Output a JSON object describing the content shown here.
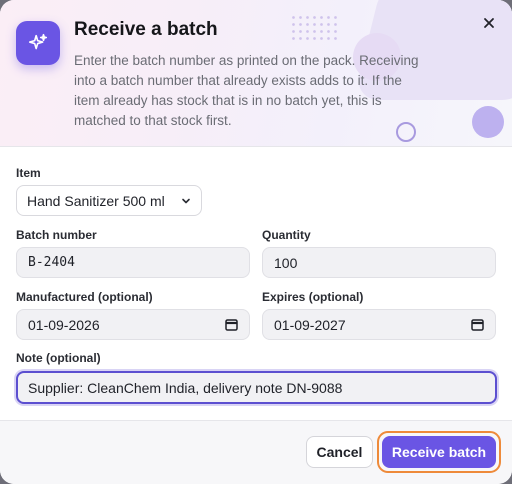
{
  "dialog": {
    "title": "Receive a batch",
    "description": "Enter the batch number as printed on the pack. Receiving into a batch number that already exists adds to it. If the item already has stock that is in no batch yet, this is matched to that stock first.",
    "icons": {
      "badge": "sparkles-icon",
      "close": "close-icon"
    },
    "accent_color": "#6a55e4"
  },
  "form": {
    "item": {
      "label": "Item",
      "value": "Hand Sanitizer 500 ml"
    },
    "batch_number": {
      "label": "Batch number",
      "value": "B-2404"
    },
    "quantity": {
      "label": "Quantity",
      "value": "100"
    },
    "manufactured": {
      "label": "Manufactured (optional)",
      "value": "01-09-2026"
    },
    "expires": {
      "label": "Expires (optional)",
      "value": "01-09-2027"
    },
    "note": {
      "label": "Note (optional)",
      "value": "Supplier: CleanChem India, delivery note DN-9088"
    }
  },
  "footer": {
    "cancel_label": "Cancel",
    "submit_label": "Receive batch"
  }
}
